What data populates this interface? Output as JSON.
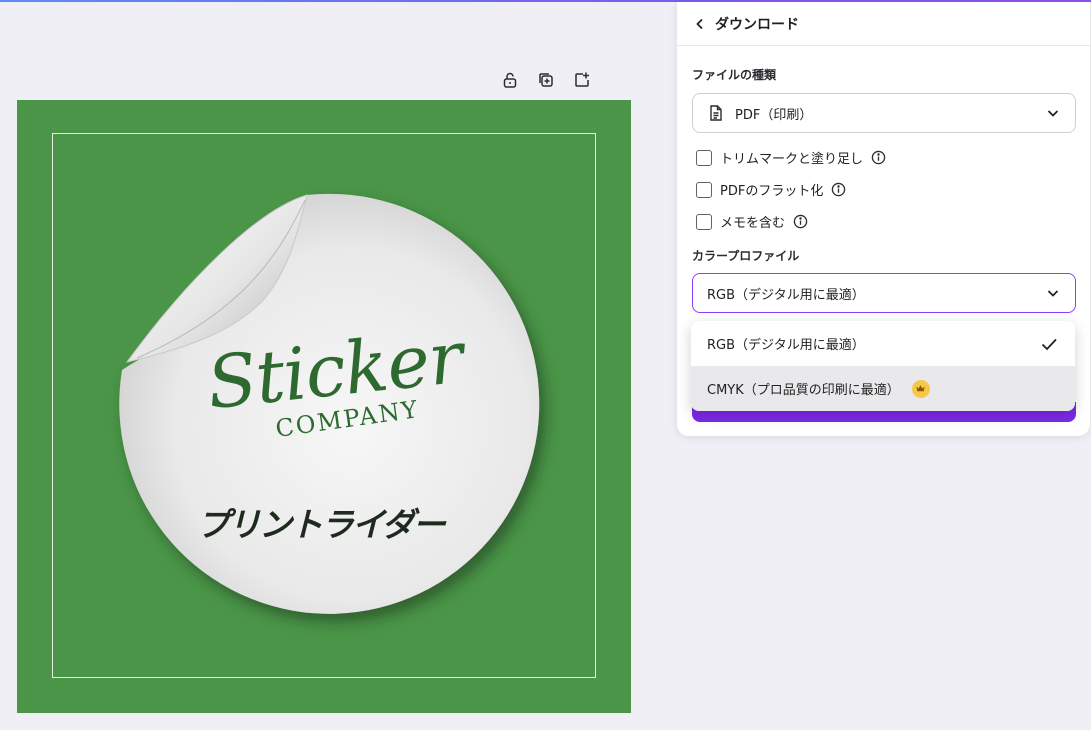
{
  "panel": {
    "title": "ダウンロード",
    "file_type_label": "ファイルの種類",
    "file_type_value": "PDF（印刷）",
    "options": [
      {
        "label": "トリムマークと塗り足し",
        "checked": false
      },
      {
        "label": "PDFのフラット化",
        "checked": false
      },
      {
        "label": "メモを含む",
        "checked": false
      }
    ],
    "color_profile_label": "カラープロファイル",
    "color_profile_value": "RGB（デジタル用に最適）"
  },
  "dropdown": {
    "items": [
      {
        "label": "RGB（デジタル用に最適）",
        "selected": true
      },
      {
        "label": "CMYK（プロ品質の印刷に最適）",
        "premium": true
      }
    ]
  },
  "design": {
    "background_color": "#4a9548",
    "script_text": "Sticker",
    "company_text": "COMPANY",
    "katakana_text": "プリントライダー"
  },
  "colors": {
    "accent": "#8b3dff",
    "premium": "#f6c84a"
  }
}
